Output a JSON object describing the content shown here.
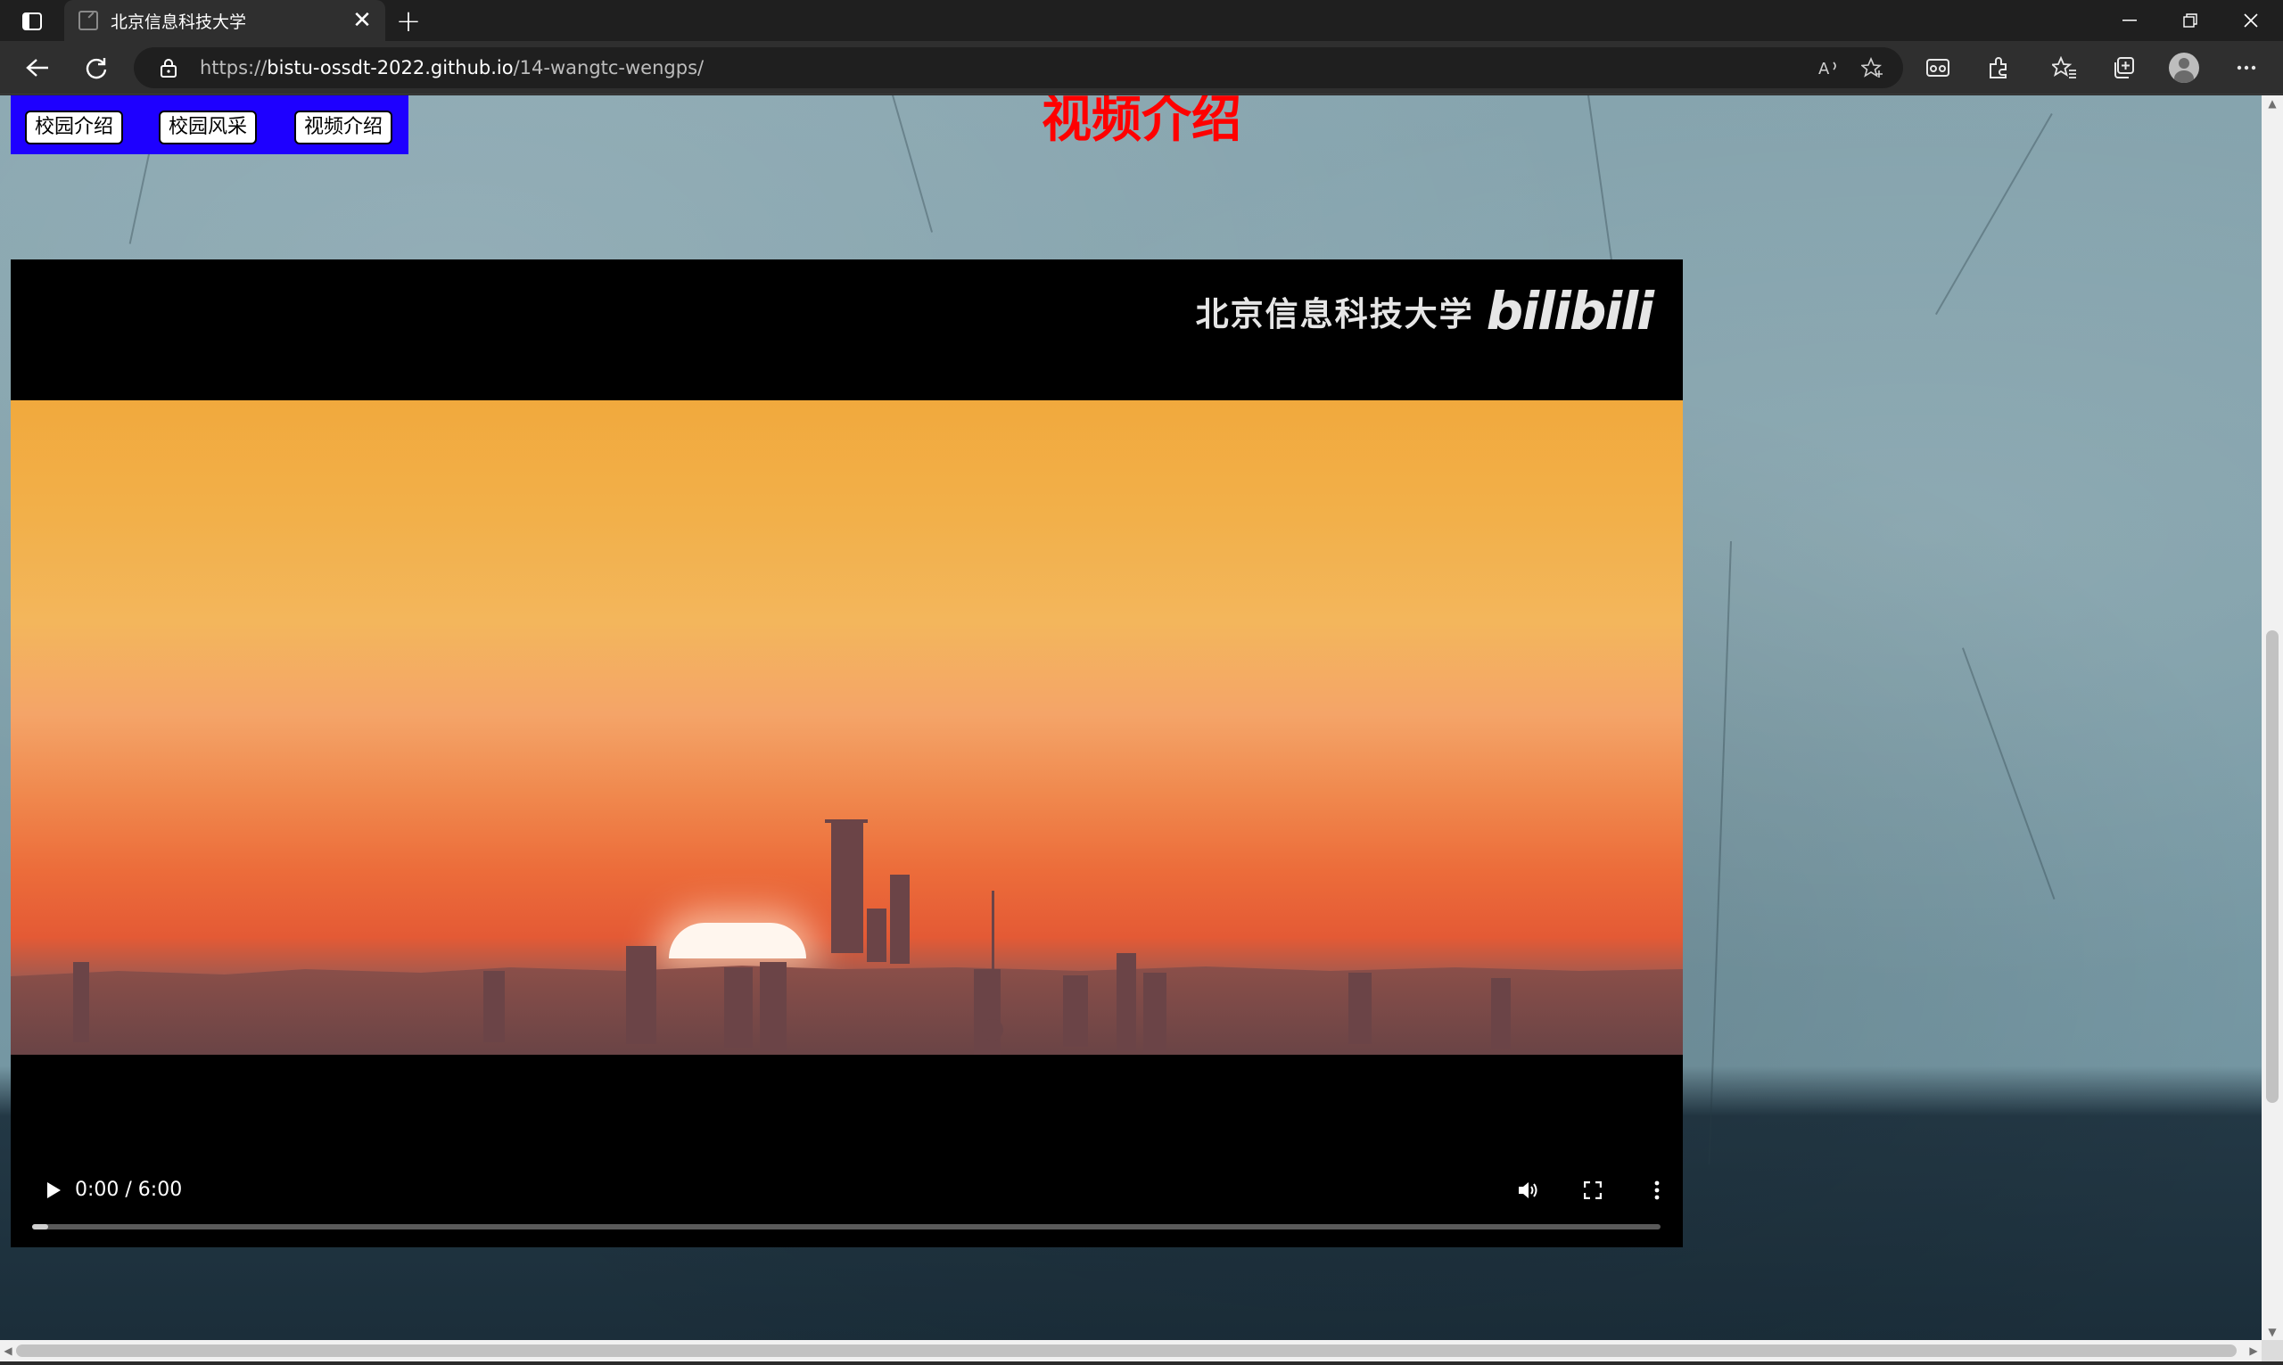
{
  "browser": {
    "tab_title": "北京信息科技大学",
    "url_scheme": "https://",
    "url_host": "bistu-ossdt-2022.github.io",
    "url_path": "/14-wangtc-wengps/",
    "new_tab_label": "+",
    "close_label": "✕"
  },
  "page": {
    "nav_buttons": [
      {
        "label": "校园介绍"
      },
      {
        "label": "校园风采"
      },
      {
        "label": "视频介绍"
      }
    ],
    "heading": "视频介绍",
    "heading_color": "#ff0000",
    "nav_bg_color": "#1e00ff"
  },
  "video": {
    "watermark_text": "北京信息科技大学",
    "watermark_logo": "bilibili",
    "time_display": "0:00 / 6:00",
    "progress_fraction": 0,
    "icons": {
      "play": "play-icon",
      "volume": "volume-icon",
      "fullscreen": "fullscreen-icon",
      "more": "more-options-icon"
    }
  }
}
